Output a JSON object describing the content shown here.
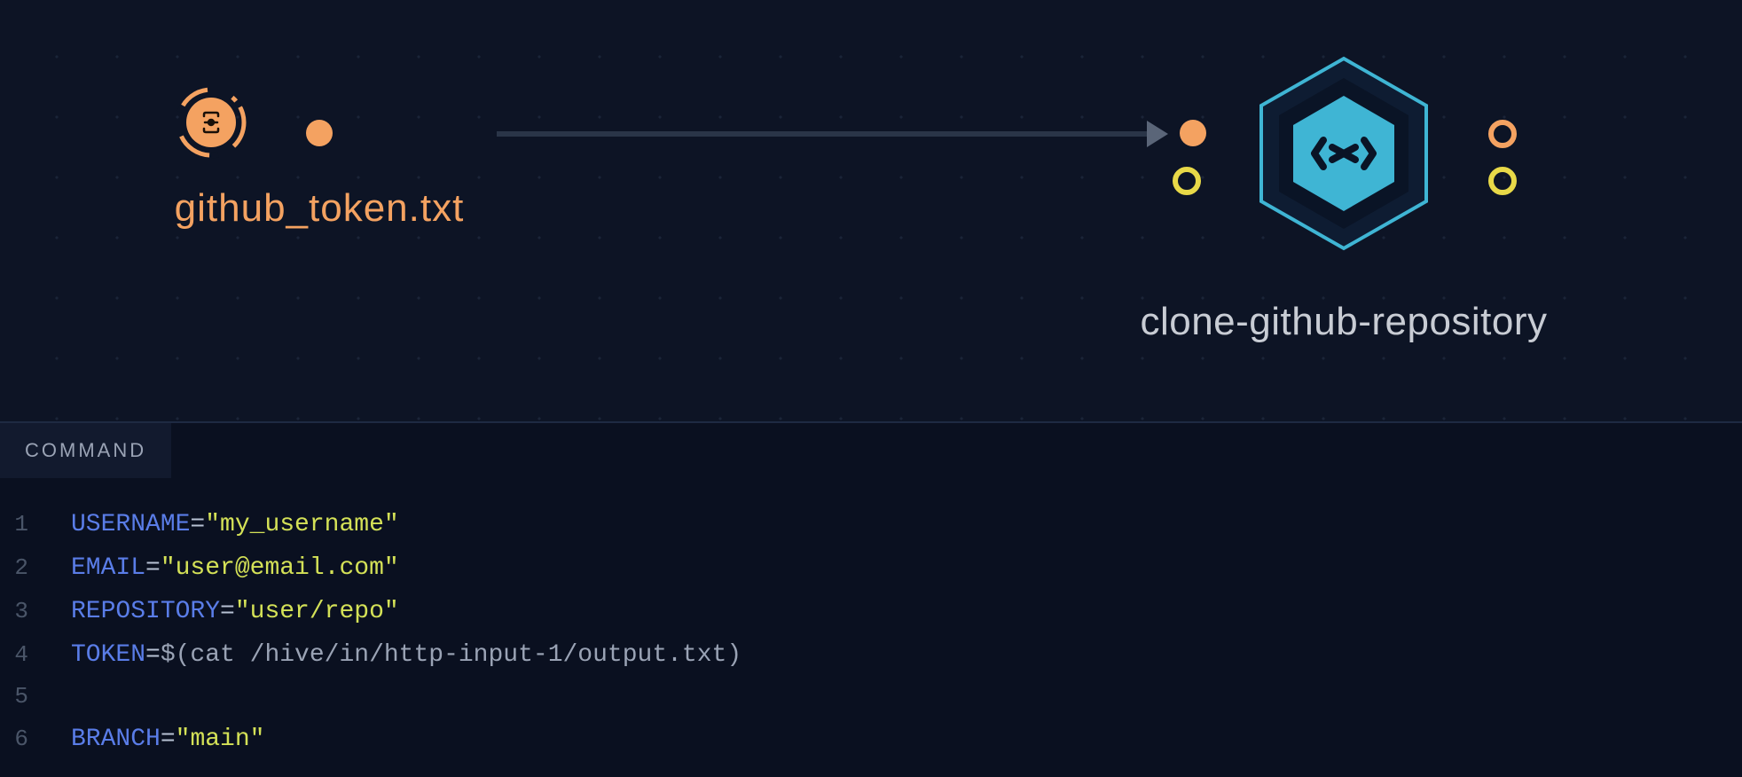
{
  "nodes": {
    "source": {
      "label": "github_token.txt",
      "icon": "data-source-icon"
    },
    "target": {
      "label": "clone-github-repository",
      "icon": "hex-processor-icon"
    }
  },
  "panel": {
    "tab": "COMMAND"
  },
  "code": {
    "lines": [
      {
        "n": "1",
        "tokens": [
          [
            "var",
            "USERNAME"
          ],
          [
            "eq",
            "="
          ],
          [
            "str",
            "\"my_username\""
          ]
        ]
      },
      {
        "n": "2",
        "tokens": [
          [
            "var",
            "EMAIL"
          ],
          [
            "eq",
            "="
          ],
          [
            "str",
            "\"user@email.com\""
          ]
        ]
      },
      {
        "n": "3",
        "tokens": [
          [
            "var",
            "REPOSITORY"
          ],
          [
            "eq",
            "="
          ],
          [
            "str",
            "\"user/repo\""
          ]
        ]
      },
      {
        "n": "4",
        "tokens": [
          [
            "var",
            "TOKEN"
          ],
          [
            "eq",
            "="
          ],
          [
            "plain",
            "$(cat /hive/in/http-input-1/output.txt)"
          ]
        ]
      },
      {
        "n": "5",
        "tokens": []
      },
      {
        "n": "6",
        "tokens": [
          [
            "var",
            "BRANCH"
          ],
          [
            "eq",
            "="
          ],
          [
            "str",
            "\"main\""
          ]
        ]
      }
    ]
  }
}
